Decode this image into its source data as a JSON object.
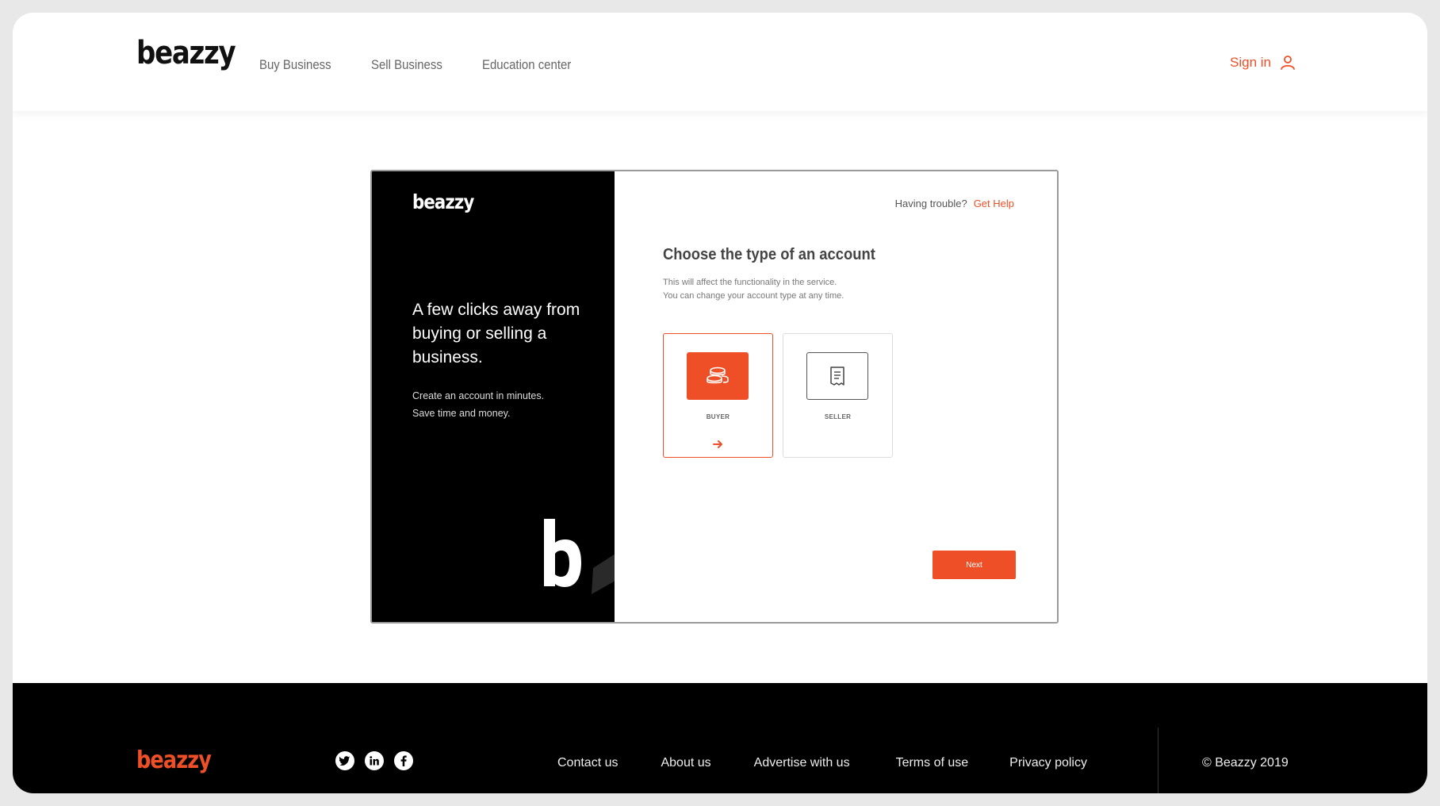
{
  "header": {
    "logo": "beazzy",
    "nav": [
      "Buy Business",
      "Sell Business",
      "Education center"
    ],
    "signin_label": "Sign in"
  },
  "modal": {
    "left": {
      "logo": "beazzy",
      "headline": "A few clicks away from buying or selling a business.",
      "sub_line1": "Create an account in minutes.",
      "sub_line2": "Save time and money."
    },
    "right": {
      "trouble_text": "Having trouble?",
      "help_link": "Get Help",
      "title": "Choose the type of an account",
      "desc_line1": "This will affect the functionality in the service.",
      "desc_line2": "You can change your account type at any time.",
      "options": [
        {
          "label": "BUYER",
          "icon": "coins-icon",
          "selected": true
        },
        {
          "label": "SELLER",
          "icon": "receipt-icon",
          "selected": false
        }
      ],
      "next_label": "Next"
    }
  },
  "footer": {
    "logo": "beazzy",
    "socials": [
      "twitter-icon",
      "linkedin-icon",
      "facebook-icon"
    ],
    "links": [
      "Contact us",
      "About us",
      "Advertise with us",
      "Terms of use",
      "Privacy policy"
    ],
    "copyright": "© Beazzy 2019"
  },
  "colors": {
    "accent": "#ee4f26",
    "dark": "#000000",
    "background": "#ffffff"
  }
}
